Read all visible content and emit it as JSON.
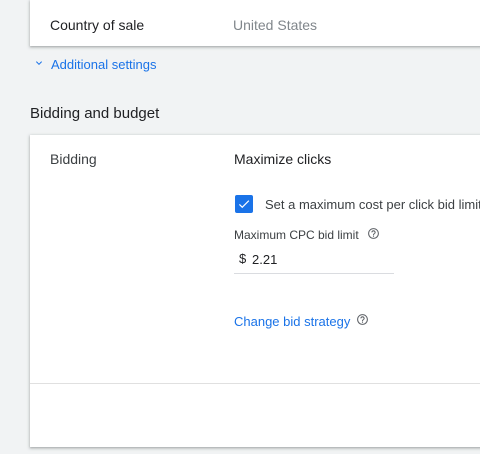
{
  "country": {
    "label": "Country of sale",
    "value": "United States"
  },
  "additional_settings": {
    "label": "Additional settings",
    "icon": "chevron-down-icon"
  },
  "section": {
    "title": "Bidding and budget"
  },
  "bidding": {
    "label": "Bidding",
    "strategy": "Maximize clicks",
    "checkbox_label": "Set a maximum cost per click bid limit",
    "checkbox_checked": true,
    "cpc_label": "Maximum CPC bid limit",
    "currency": "$",
    "cpc_value": "2.21",
    "change_link": "Change bid strategy"
  },
  "colors": {
    "accent": "#1a73e8",
    "background": "#f1f3f4",
    "card": "#ffffff"
  }
}
